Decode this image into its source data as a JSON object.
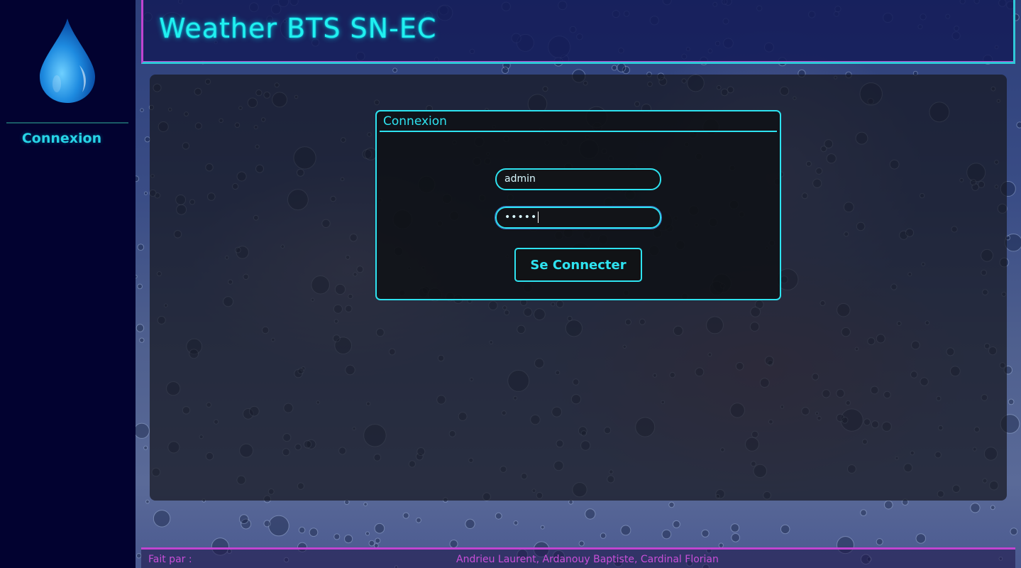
{
  "app": {
    "title": "Weather BTS SN-EC",
    "logo_icon": "water-drop-icon"
  },
  "sidebar": {
    "items": [
      {
        "label": "Connexion"
      }
    ]
  },
  "login": {
    "legend": "Connexion",
    "username_value": "admin",
    "password_masked": "•••••",
    "submit_label": "Se Connecter"
  },
  "footer": {
    "label": "Fait par :",
    "authors": "Andrieu Laurent, Ardanouy Baptiste, Cardinal Florian"
  },
  "colors": {
    "accent_cyan": "#2ee3f0",
    "accent_magenta": "#c044d0",
    "sidebar_bg": "#020230"
  }
}
